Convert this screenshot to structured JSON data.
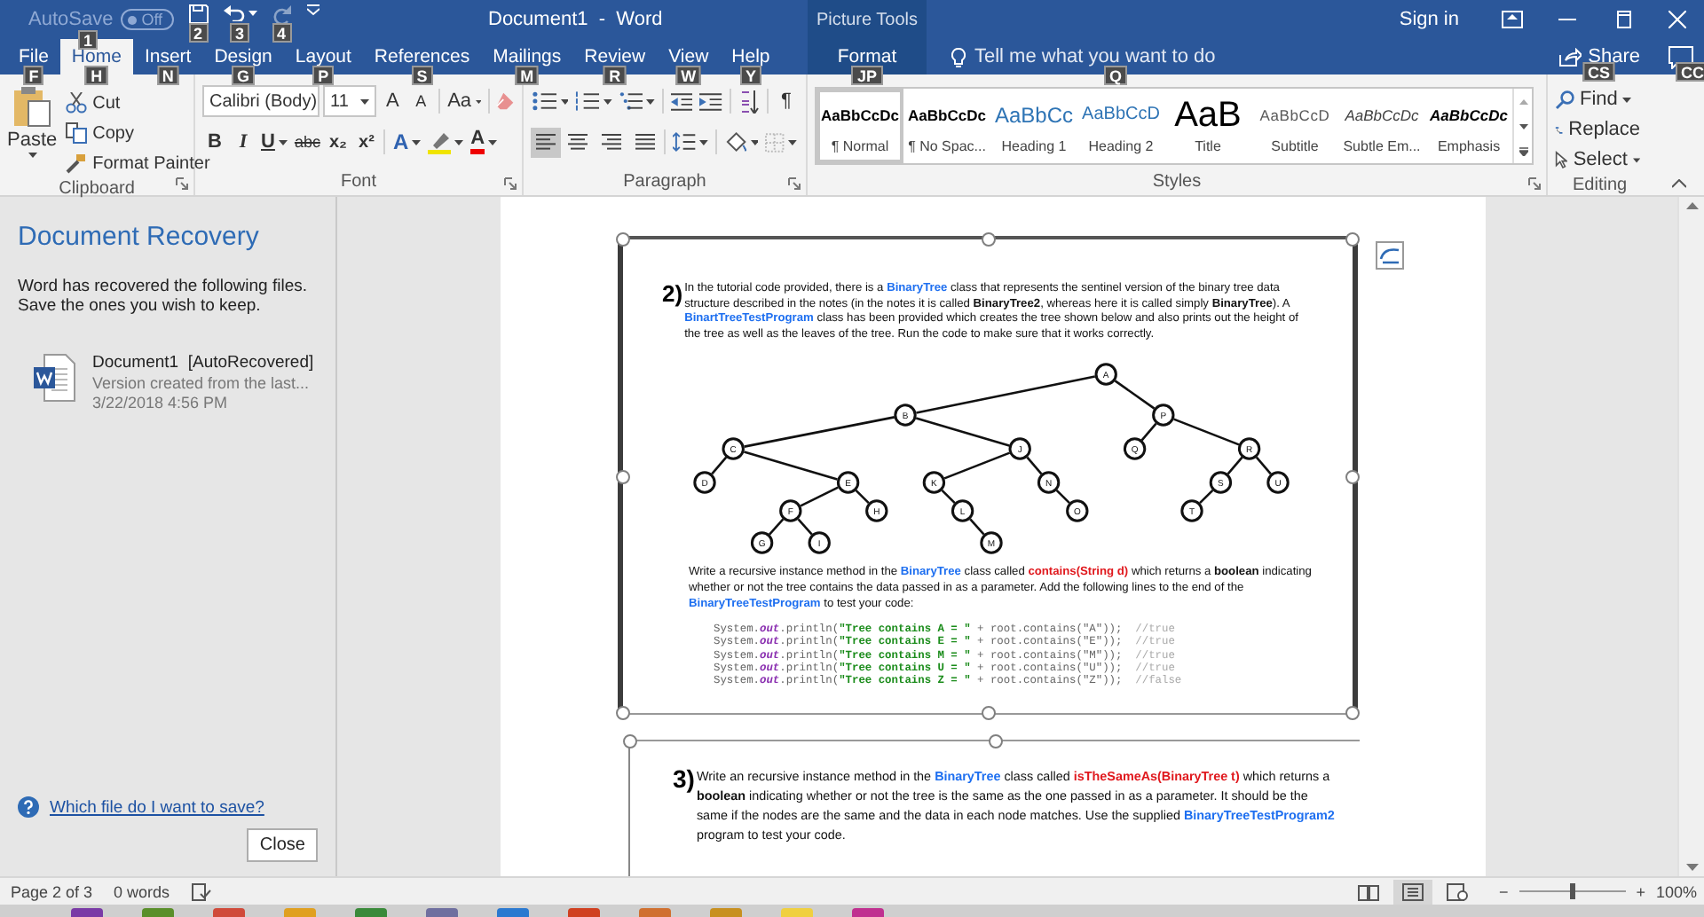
{
  "title_bar": {
    "autosave": {
      "label": "AutoSave",
      "state": "Off",
      "on": false,
      "keytip": "1"
    },
    "quick_access": [
      {
        "kind": "save",
        "keytip": "2",
        "disabled": false
      },
      {
        "kind": "undo",
        "keytip": "3",
        "disabled": false
      },
      {
        "kind": "redo",
        "keytip": "4",
        "disabled": true
      }
    ],
    "title": "Document1  -  Word",
    "context_group": "Picture Tools",
    "sign_in": "Sign in"
  },
  "tabs": [
    {
      "label": "File",
      "keytip": "F",
      "selected": false
    },
    {
      "label": "Home",
      "keytip": "H",
      "selected": true
    },
    {
      "label": "Insert",
      "keytip": "N",
      "selected": false
    },
    {
      "label": "Design",
      "keytip": "G",
      "selected": false
    },
    {
      "label": "Layout",
      "keytip": "P",
      "selected": false
    },
    {
      "label": "References",
      "keytip": "S",
      "selected": false
    },
    {
      "label": "Mailings",
      "keytip": "M",
      "selected": false
    },
    {
      "label": "Review",
      "keytip": "R",
      "selected": false
    },
    {
      "label": "View",
      "keytip": "W",
      "selected": false
    },
    {
      "label": "Help",
      "keytip": "Y",
      "selected": false
    },
    {
      "label": "Format",
      "keytip": "JP",
      "selected": false
    }
  ],
  "tell_me": {
    "placeholder": "Tell me what you want to do",
    "keytip": "Q"
  },
  "share": {
    "label": "Share",
    "keytip": "CS"
  },
  "comments": {
    "keytip": "CC"
  },
  "ribbon": {
    "clipboard": {
      "label": "Clipboard",
      "paste": "Paste",
      "cut": "Cut",
      "copy": "Copy",
      "format_painter": "Format Painter"
    },
    "font": {
      "label": "Font",
      "name": "Calibri (Body)",
      "size": "11",
      "grow_font": "A",
      "shrink_font": "A",
      "change_case": "Aa",
      "buttons": [
        {
          "kind": "bold",
          "label": "B"
        },
        {
          "kind": "italic",
          "label": "I"
        },
        {
          "kind": "underline",
          "label": "U"
        },
        {
          "kind": "strike",
          "label": "abc"
        },
        {
          "kind": "sub",
          "label": "x₂"
        },
        {
          "kind": "sup",
          "label": "x²"
        }
      ],
      "text_effects": "A",
      "font_color": "A"
    },
    "paragraph": {
      "label": "Paragraph",
      "show_marks": "¶",
      "align": [
        {
          "kind": "left",
          "selected": true
        },
        {
          "kind": "center",
          "selected": false
        },
        {
          "kind": "right",
          "selected": false
        },
        {
          "kind": "justify",
          "selected": false
        }
      ]
    },
    "styles": {
      "label": "Styles",
      "items": [
        {
          "sample": "AaBbCcDc",
          "label": "¶ Normal",
          "kind": "normal",
          "selected": true
        },
        {
          "sample": "AaBbCcDc",
          "label": "¶ No Spac...",
          "kind": "no-spacing",
          "selected": false
        },
        {
          "sample": "AaBbCc",
          "label": "Heading 1",
          "kind": "heading1",
          "selected": false
        },
        {
          "sample": "AaBbCcD",
          "label": "Heading 2",
          "kind": "heading2",
          "selected": false
        },
        {
          "sample": "AaB",
          "label": "Title",
          "kind": "title",
          "selected": false
        },
        {
          "sample": "AaBbCcD",
          "label": "Subtitle",
          "kind": "subtitle",
          "selected": false
        },
        {
          "sample": "AaBbCcDc",
          "label": "Subtle Em...",
          "kind": "subtle-emphasis",
          "selected": false
        },
        {
          "sample": "AaBbCcDc",
          "label": "Emphasis",
          "kind": "emphasis",
          "selected": false
        }
      ]
    },
    "editing": {
      "label": "Editing",
      "find": "Find",
      "replace": "Replace",
      "select": "Select"
    }
  },
  "recovery": {
    "title": "Document Recovery",
    "message": [
      "Word has recovered the following files.",
      "Save the ones you wish to keep."
    ],
    "files": [
      {
        "name": "Document1  [AutoRecovered]",
        "description": "Version created from the last...",
        "date": "3/22/2018 4:56 PM"
      }
    ],
    "help_link": "Which file do I want to save?",
    "close": "Close"
  },
  "document": {
    "question_2": {
      "number": "2)",
      "intro": [
        {
          "kind": "text",
          "text": "In the tutorial code provided, there is a "
        },
        {
          "kind": "class",
          "text": "BinaryTree"
        },
        {
          "kind": "text",
          "text": " class that represents the sentinel version of the binary tree data structure described in the notes (in the notes it is called "
        },
        {
          "kind": "strong",
          "text": "BinaryTree2"
        },
        {
          "kind": "text",
          "text": ", whereas here it is called simply "
        },
        {
          "kind": "strong",
          "text": "BinaryTree"
        },
        {
          "kind": "text",
          "text": ").   A "
        },
        {
          "kind": "class",
          "text": "BinartTreeTestProgram"
        },
        {
          "kind": "text",
          "text": " class has been provided which creates the tree shown below and also prints out the height of the tree as well as the leaves of the tree.   Run the code to make sure that it works correctly."
        }
      ],
      "tree": {
        "label": "A",
        "left": {
          "label": "B",
          "left": {
            "label": "C",
            "left": {
              "label": "D"
            },
            "right": {
              "label": "E",
              "left": {
                "label": "F",
                "left": {
                  "label": "G"
                },
                "right": {
                  "label": "I"
                }
              },
              "right": {
                "label": "H"
              }
            }
          },
          "right": {
            "label": "J",
            "left": {
              "label": "K",
              "right": {
                "label": "L",
                "right": {
                  "label": "M"
                }
              }
            },
            "right": {
              "label": "N",
              "right": {
                "label": "O"
              }
            }
          }
        },
        "right": {
          "label": "P",
          "left": {
            "label": "Q"
          },
          "right": {
            "label": "R",
            "left": {
              "label": "S",
              "left": {
                "label": "T"
              }
            },
            "right": {
              "label": "U"
            }
          }
        }
      },
      "task": [
        {
          "kind": "text",
          "text": "Write a recursive instance method in the "
        },
        {
          "kind": "class",
          "text": "BinaryTree"
        },
        {
          "kind": "text",
          "text": " class called "
        },
        {
          "kind": "method",
          "text": "contains(String d)"
        },
        {
          "kind": "text",
          "text": " which returns a "
        },
        {
          "kind": "strong",
          "text": "boolean"
        },
        {
          "kind": "text",
          "text": " indicating whether or not the tree contains the data passed in as a parameter.   Add the following lines to the end of the "
        },
        {
          "kind": "class",
          "text": "BinaryTreeTestProgram"
        },
        {
          "kind": "text",
          "text": " to test your code:"
        }
      ],
      "code": [
        [
          {
            "kind": "plain",
            "text": "System."
          },
          {
            "kind": "field",
            "text": "out"
          },
          {
            "kind": "plain",
            "text": ".println("
          },
          {
            "kind": "string",
            "text": "\"Tree contains A = \""
          },
          {
            "kind": "plain",
            "text": " + root.contains(\"A\"));  "
          },
          {
            "kind": "comment",
            "text": "//true"
          }
        ],
        [
          {
            "kind": "plain",
            "text": "System."
          },
          {
            "kind": "field",
            "text": "out"
          },
          {
            "kind": "plain",
            "text": ".println("
          },
          {
            "kind": "string",
            "text": "\"Tree contains E = \""
          },
          {
            "kind": "plain",
            "text": " + root.contains(\"E\"));  "
          },
          {
            "kind": "comment",
            "text": "//true"
          }
        ],
        [
          {
            "kind": "plain",
            "text": "System."
          },
          {
            "kind": "field",
            "text": "out"
          },
          {
            "kind": "plain",
            "text": ".println("
          },
          {
            "kind": "string",
            "text": "\"Tree contains M = \""
          },
          {
            "kind": "plain",
            "text": " + root.contains(\"M\"));  "
          },
          {
            "kind": "comment",
            "text": "//true"
          }
        ],
        [
          {
            "kind": "plain",
            "text": "System."
          },
          {
            "kind": "field",
            "text": "out"
          },
          {
            "kind": "plain",
            "text": ".println("
          },
          {
            "kind": "string",
            "text": "\"Tree contains U = \""
          },
          {
            "kind": "plain",
            "text": " + root.contains(\"U\"));  "
          },
          {
            "kind": "comment",
            "text": "//true"
          }
        ],
        [
          {
            "kind": "plain",
            "text": "System."
          },
          {
            "kind": "field",
            "text": "out"
          },
          {
            "kind": "plain",
            "text": ".println("
          },
          {
            "kind": "string",
            "text": "\"Tree contains Z = \""
          },
          {
            "kind": "plain",
            "text": " + root.contains(\"Z\"));  "
          },
          {
            "kind": "comment",
            "text": "//false"
          }
        ]
      ]
    },
    "question_3": {
      "number": "3)",
      "text": [
        {
          "kind": "text",
          "text": "Write an recursive instance method in the "
        },
        {
          "kind": "class",
          "text": "BinaryTree"
        },
        {
          "kind": "text",
          "text": " class called "
        },
        {
          "kind": "method",
          "text": "isTheSameAs(BinaryTree t)"
        },
        {
          "kind": "text",
          "text": " which returns a "
        },
        {
          "kind": "strong",
          "text": "boolean"
        },
        {
          "kind": "text",
          "text": " indicating whether or not the tree is the same as the one passed in as a parameter.   It should be the same if the nodes are the same and the data in each node matches.   Use the supplied "
        },
        {
          "kind": "class",
          "text": "BinaryTreeTestProgram2"
        },
        {
          "kind": "text",
          "text": " program to test your code."
        }
      ]
    }
  },
  "status_bar": {
    "page": "Page 2 of 3",
    "words": "0 words",
    "views": [
      {
        "kind": "read",
        "selected": false
      },
      {
        "kind": "print",
        "selected": true
      },
      {
        "kind": "web",
        "selected": false
      }
    ],
    "zoom_out": "−",
    "zoom_in": "+",
    "zoom": {
      "level": 0.5
    },
    "zoom_label": "100%"
  }
}
